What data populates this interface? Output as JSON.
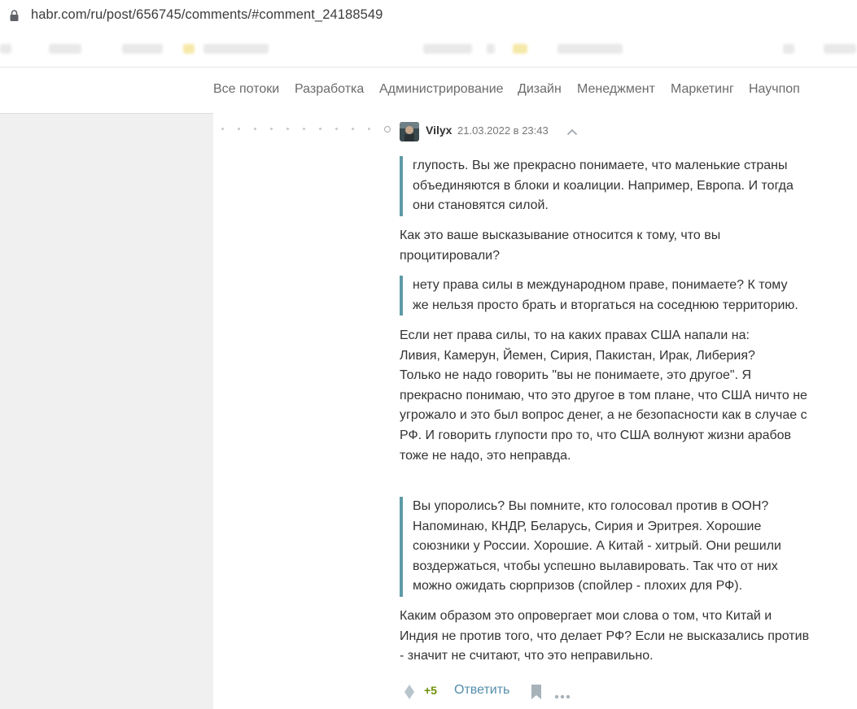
{
  "browser": {
    "url": "habr.com/ru/post/656745/comments/#comment_24188549"
  },
  "nav": {
    "items": [
      "Все потоки",
      "Разработка",
      "Администрирование",
      "Дизайн",
      "Менеджмент",
      "Маркетинг",
      "Научпоп"
    ]
  },
  "comment": {
    "username": "Vilyx",
    "datetime": "21.03.2022 в 23:43",
    "quote1": [
      "глупость. Вы же прекрасно понимаете, что маленькие страны",
      "объединяются в блоки и коалиции. Например, Европа. И тогда",
      "они становятся силой."
    ],
    "para1": [
      "Как это ваше высказывание относится к тому, что вы",
      "процитировали?"
    ],
    "quote2": [
      "нету права силы в международном праве, понимаете? К тому",
      "же нельзя просто брать и вторгаться на соседнюю территорию."
    ],
    "para2": [
      "Если нет права силы, то на каких правах США напали на:",
      "Ливия, Камерун, Йемен, Сирия, Пакистан, Ирак, Либерия?",
      "Только не надо говорить \"вы не понимаете, это другое\". Я",
      "прекрасно понимаю, что это другое в том плане, что США ничто не",
      "угрожало и это был вопрос денег, а не безопасности как в случае с",
      "РФ. И говорить глупости про то, что США волнуют жизни арабов",
      "тоже не надо, это неправда."
    ],
    "quote3": [
      "Вы упоролись? Вы помните, кто голосовал против в ООН?",
      "Напоминаю, КНДР, Беларусь, Сирия и Эритрея. Хорошие",
      "союзники у России. Хорошие. А Китай - хитрый. Они решили",
      "воздержаться, чтобы успешно вылавировать. Так что от них",
      "можно ожидать сюрпризов (спойлер - плохих для РФ)."
    ],
    "para3": [
      "Каким образом это опровергает мои слова о том, что Китай и",
      "Индия не против того, что делает РФ? Если не высказались против",
      "- значит не считают, что это неправильно."
    ],
    "score": "+5",
    "reply_label": "Ответить"
  },
  "colors": {
    "quote_border": "#5e9ba7",
    "reply_link": "#548eaa",
    "score_positive": "#6c9007"
  }
}
